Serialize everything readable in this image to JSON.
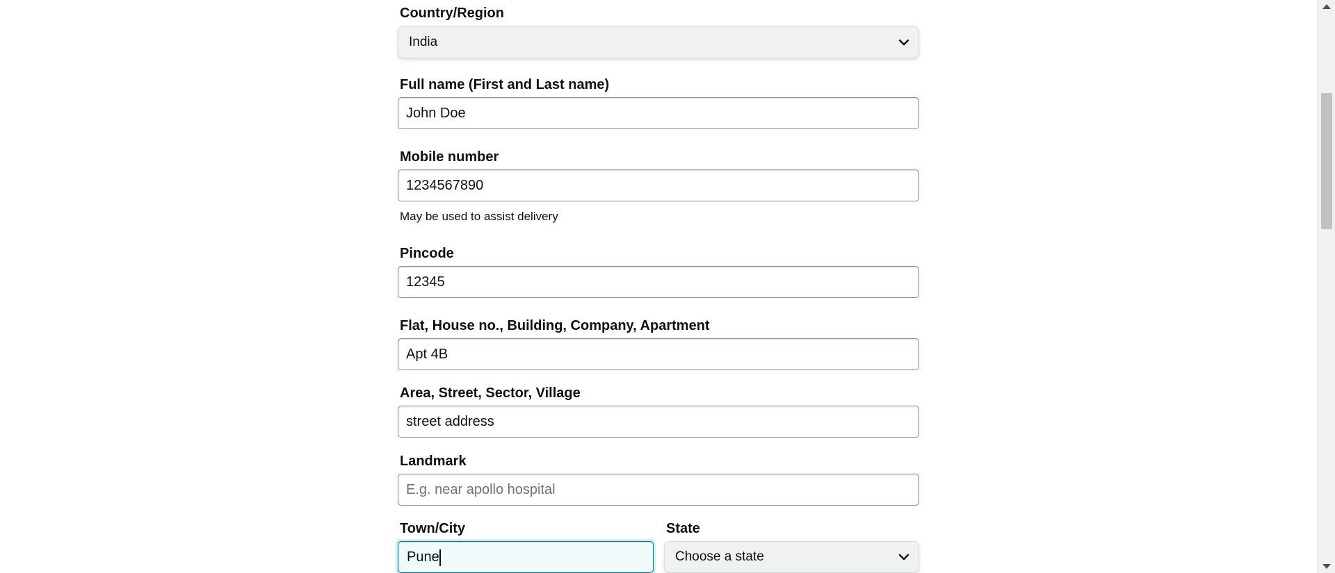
{
  "form": {
    "country": {
      "label": "Country/Region",
      "value": "India",
      "icon": "chevron-down-icon"
    },
    "full_name": {
      "label": "Full name (First and Last name)",
      "value": "John Doe"
    },
    "mobile": {
      "label": "Mobile number",
      "value": "1234567890",
      "hint": "May be used to assist delivery"
    },
    "pincode": {
      "label": "Pincode",
      "value": "12345"
    },
    "flat": {
      "label": "Flat, House no., Building, Company, Apartment",
      "value": "Apt 4B"
    },
    "area": {
      "label": "Area, Street, Sector, Village",
      "value": "street address"
    },
    "landmark": {
      "label": "Landmark",
      "value": "",
      "placeholder": "E.g. near apollo hospital"
    },
    "city": {
      "label": "Town/City",
      "value": "Pune"
    },
    "state": {
      "label": "State",
      "value": "Choose a state",
      "icon": "chevron-down-icon"
    }
  },
  "colors": {
    "focus_border": "#007185",
    "select_bg": "#f0f2f2",
    "text": "#0f1111"
  }
}
